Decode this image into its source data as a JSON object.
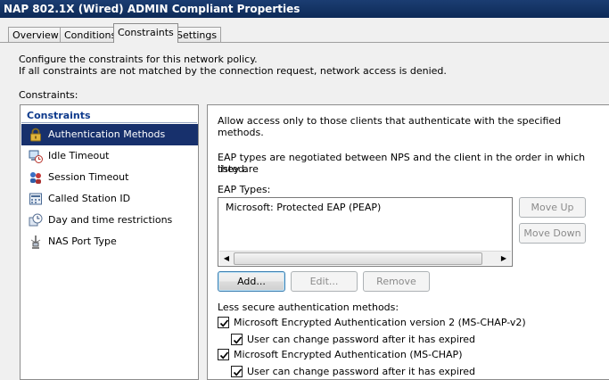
{
  "window": {
    "title": "NAP 802.1X (Wired) ADMIN Compliant Properties"
  },
  "tabs": [
    {
      "label": "Overview"
    },
    {
      "label": "Conditions"
    },
    {
      "label": "Constraints"
    },
    {
      "label": "Settings"
    }
  ],
  "intro": {
    "line1": "Configure the constraints for this network policy.",
    "line2": "If all constraints are not matched by the connection request, network access is denied."
  },
  "constraints_label": "Constraints:",
  "list": {
    "header": "Constraints",
    "items": [
      {
        "label": "Authentication Methods",
        "icon": "lock-icon",
        "selected": true
      },
      {
        "label": "Idle Timeout",
        "icon": "idle-timeout-icon"
      },
      {
        "label": "Session Timeout",
        "icon": "session-timeout-icon"
      },
      {
        "label": "Called Station ID",
        "icon": "called-station-icon"
      },
      {
        "label": "Day and time restrictions",
        "icon": "clock-icon"
      },
      {
        "label": "NAS Port Type",
        "icon": "network-port-icon"
      }
    ]
  },
  "detail": {
    "description": "Allow access only to those clients that authenticate with the specified methods.",
    "eap_note_line1": "EAP types are negotiated between NPS and the client in the order in which they are",
    "eap_note_line2": "listed.",
    "eap_types_label": "EAP Types:",
    "eap_types": [
      "Microsoft: Protected EAP (PEAP)"
    ],
    "move_up": "Move Up",
    "move_down": "Move Down",
    "add": "Add...",
    "edit": "Edit...",
    "remove": "Remove",
    "less_secure_label": "Less secure authentication methods:",
    "options": [
      {
        "label": "Microsoft Encrypted Authentication version 2 (MS-CHAP-v2)",
        "checked": true
      },
      {
        "label": "User can change password after it has expired",
        "checked": true
      },
      {
        "label": "Microsoft Encrypted Authentication (MS-CHAP)",
        "checked": true
      },
      {
        "label": "User can change password after it has expired",
        "checked": true
      }
    ]
  }
}
